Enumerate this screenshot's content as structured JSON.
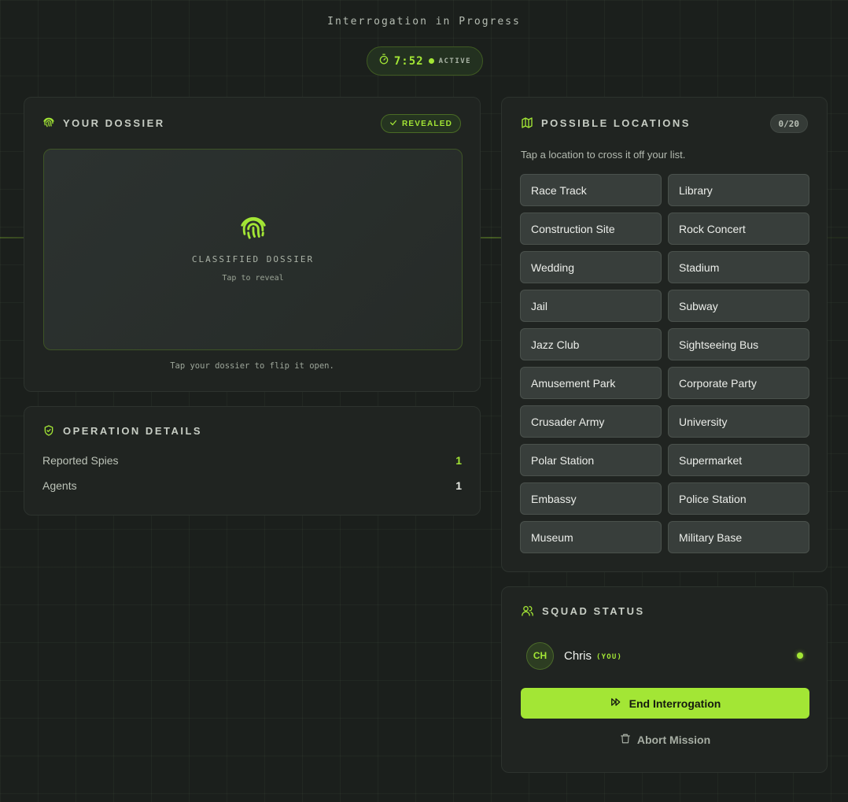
{
  "header": {
    "title": "Interrogation in Progress",
    "timer": "7:52",
    "status": "ACTIVE"
  },
  "dossier": {
    "title": "YOUR DOSSIER",
    "badge": "REVEALED",
    "label": "CLASSIFIED DOSSIER",
    "sublabel": "Tap to reveal",
    "hint": "Tap your dossier to flip it open."
  },
  "operation": {
    "title": "OPERATION DETAILS",
    "rows": [
      {
        "label": "Reported Spies",
        "value": "1"
      },
      {
        "label": "Agents",
        "value": "1"
      }
    ]
  },
  "locations": {
    "title": "POSSIBLE LOCATIONS",
    "count": "0/20",
    "hint": "Tap a location to cross it off your list.",
    "items": [
      "Race Track",
      "Library",
      "Construction Site",
      "Rock Concert",
      "Wedding",
      "Stadium",
      "Jail",
      "Subway",
      "Jazz Club",
      "Sightseeing Bus",
      "Amusement Park",
      "Corporate Party",
      "Crusader Army",
      "University",
      "Polar Station",
      "Supermarket",
      "Embassy",
      "Police Station",
      "Museum",
      "Military Base"
    ]
  },
  "squad": {
    "title": "SQUAD STATUS",
    "members": [
      {
        "initials": "CH",
        "name": "Chris",
        "tag": "(YOU)",
        "status": "online"
      }
    ],
    "end_label": "End Interrogation",
    "abort_label": "Abort Mission"
  },
  "colors": {
    "accent": "#a3e635",
    "background": "#1b1f1c",
    "card": "#202421"
  }
}
